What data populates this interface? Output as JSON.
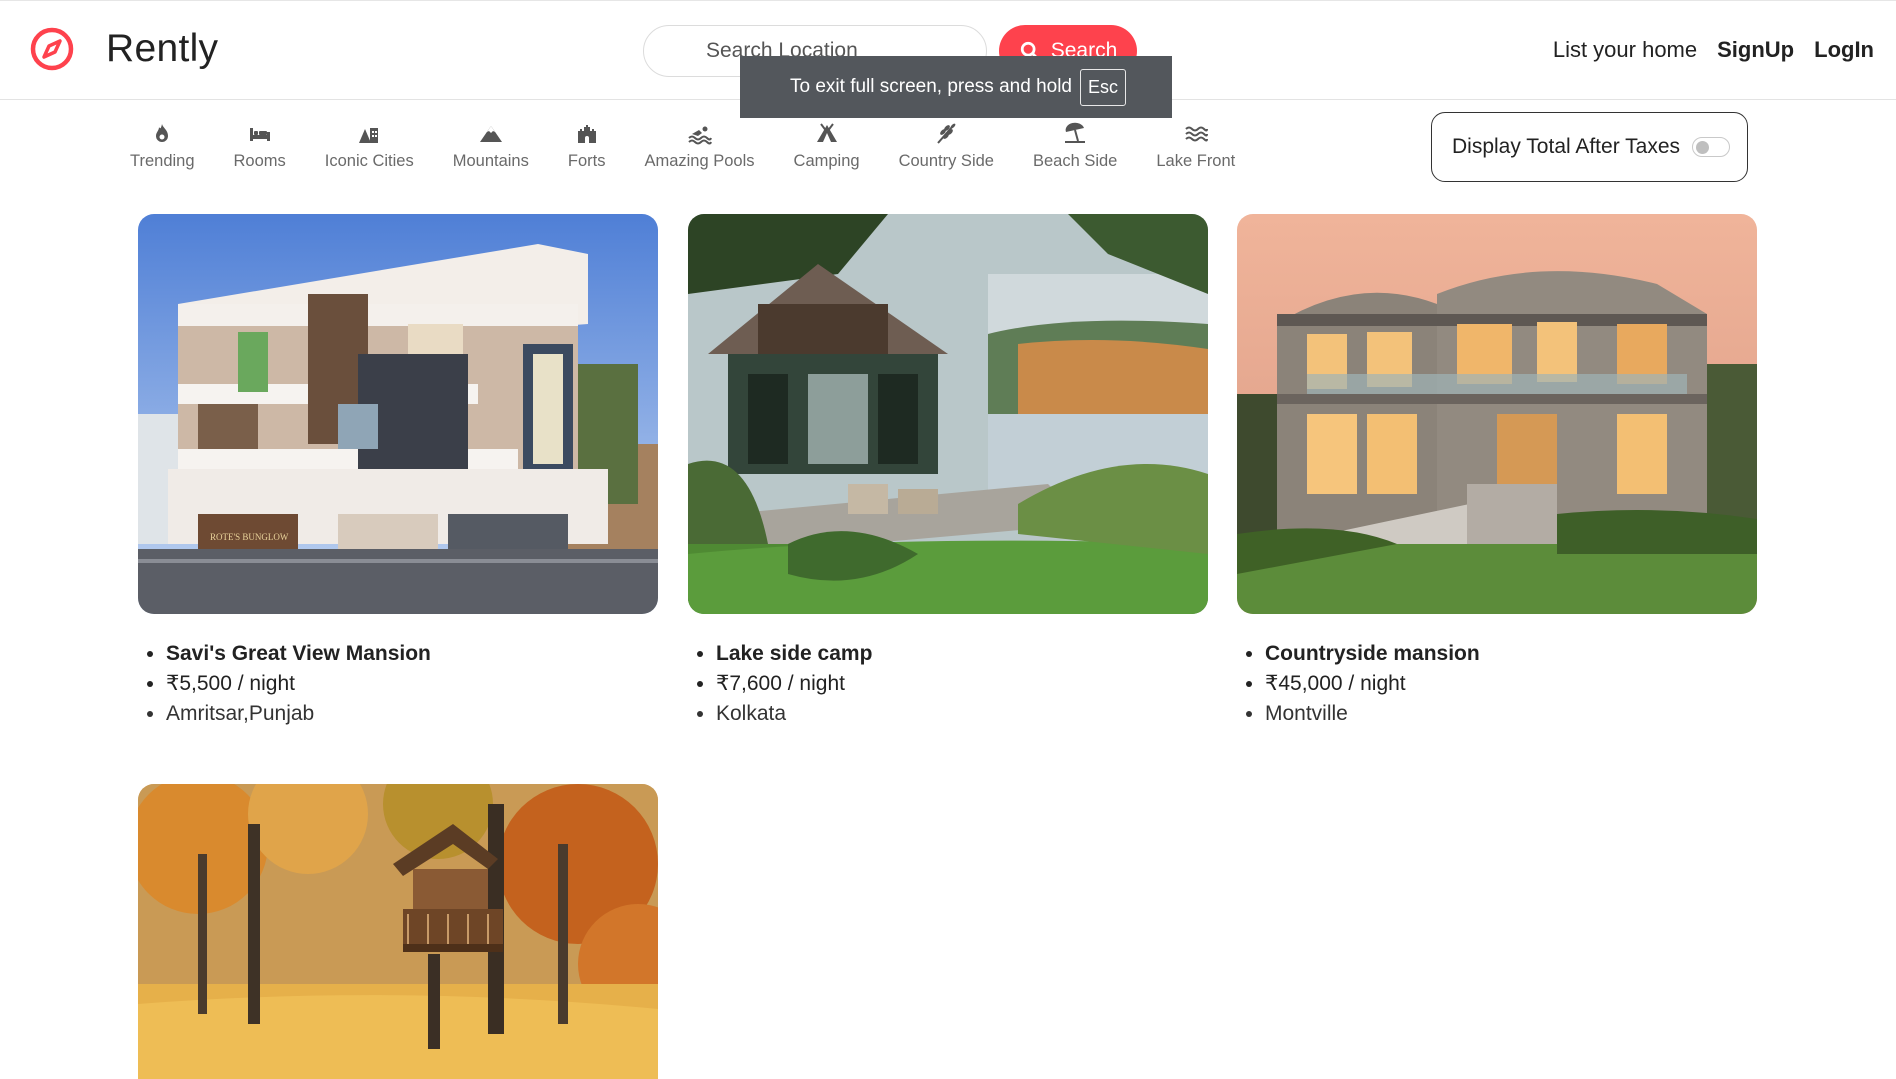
{
  "brand": {
    "name": "Rently"
  },
  "search": {
    "placeholder": "Search Location",
    "button_label": "Search"
  },
  "nav": {
    "list_home": "List your home",
    "signup": "SignUp",
    "login": "LogIn"
  },
  "fullscreen_toast": {
    "text": "To exit full screen, press and hold",
    "key": "Esc"
  },
  "filters": [
    {
      "label": "Trending",
      "icon": "fire-icon"
    },
    {
      "label": "Rooms",
      "icon": "bed-icon"
    },
    {
      "label": "Iconic Cities",
      "icon": "city-icon"
    },
    {
      "label": "Mountains",
      "icon": "mountain-icon"
    },
    {
      "label": "Forts",
      "icon": "fort-icon"
    },
    {
      "label": "Amazing Pools",
      "icon": "pool-icon"
    },
    {
      "label": "Camping",
      "icon": "tent-icon"
    },
    {
      "label": "Country Side",
      "icon": "wheat-icon"
    },
    {
      "label": "Beach Side",
      "icon": "umbrella-beach-icon"
    },
    {
      "label": "Lake Front",
      "icon": "water-icon"
    }
  ],
  "tax_toggle": {
    "label": "Display Total After Taxes",
    "enabled": false
  },
  "listings": [
    {
      "title": "Savi's Great View Mansion",
      "price": "₹5,500 / night",
      "location": "Amritsar,Punjab",
      "sign_text": "ROTE'S BUNGLOW"
    },
    {
      "title": "Lake side camp",
      "price": "₹7,600 / night",
      "location": "Kolkata"
    },
    {
      "title": "Countryside mansion",
      "price": "₹45,000 / night",
      "location": "Montville"
    },
    {
      "title": "",
      "price": "",
      "location": ""
    }
  ],
  "colors": {
    "brand": "#fe424d",
    "toast": "#53575c"
  }
}
